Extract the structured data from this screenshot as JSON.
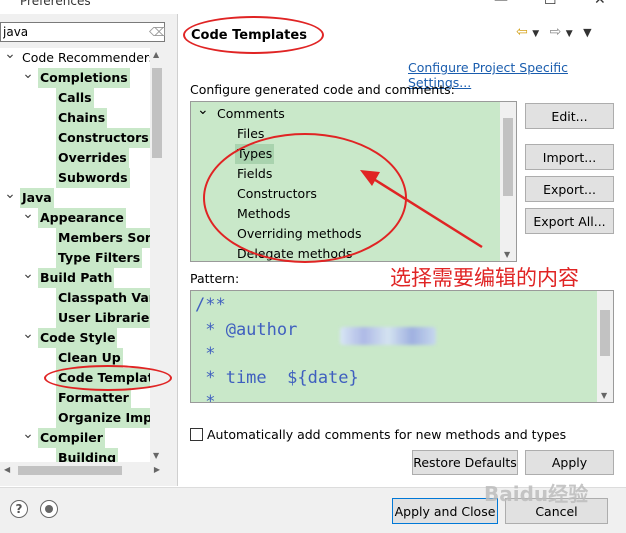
{
  "window": {
    "title": "Preferences",
    "minimize": "—",
    "maximize": "☐",
    "close": "✕"
  },
  "filter": {
    "value": "java",
    "clear_icon": "⌫"
  },
  "tree": [
    {
      "label": "Code Recommenders",
      "level": 0,
      "twisty": "open",
      "highlight": false
    },
    {
      "label": "Completions",
      "level": 1,
      "twisty": "open",
      "highlight": true
    },
    {
      "label": "Calls",
      "level": 2,
      "twisty": "none",
      "highlight": true
    },
    {
      "label": "Chains",
      "level": 2,
      "twisty": "none",
      "highlight": true
    },
    {
      "label": "Constructors",
      "level": 2,
      "twisty": "none",
      "highlight": true
    },
    {
      "label": "Overrides",
      "level": 2,
      "twisty": "none",
      "highlight": true
    },
    {
      "label": "Subwords",
      "level": 2,
      "twisty": "none",
      "highlight": true
    },
    {
      "label": "Java",
      "level": 0,
      "twisty": "open",
      "highlight": true
    },
    {
      "label": "Appearance",
      "level": 1,
      "twisty": "open",
      "highlight": true
    },
    {
      "label": "Members Sort",
      "level": 2,
      "twisty": "none",
      "highlight": true
    },
    {
      "label": "Type Filters",
      "level": 2,
      "twisty": "none",
      "highlight": true
    },
    {
      "label": "Build Path",
      "level": 1,
      "twisty": "open",
      "highlight": true
    },
    {
      "label": "Classpath Vari",
      "level": 2,
      "twisty": "none",
      "highlight": true
    },
    {
      "label": "User Libraries",
      "level": 2,
      "twisty": "none",
      "highlight": true
    },
    {
      "label": "Code Style",
      "level": 1,
      "twisty": "open",
      "highlight": true
    },
    {
      "label": "Clean Up",
      "level": 2,
      "twisty": "none",
      "highlight": true
    },
    {
      "label": "Code Templat",
      "level": 2,
      "twisty": "none",
      "highlight": true
    },
    {
      "label": "Formatter",
      "level": 2,
      "twisty": "none",
      "highlight": true
    },
    {
      "label": "Organize Impo",
      "level": 2,
      "twisty": "none",
      "highlight": true
    },
    {
      "label": "Compiler",
      "level": 1,
      "twisty": "open",
      "highlight": true
    },
    {
      "label": "Building",
      "level": 2,
      "twisty": "none",
      "highlight": true
    }
  ],
  "page": {
    "title": "Code Templates",
    "configure_link": "Configure Project Specific Settings...",
    "configure_label": "Configure generated code and comments:",
    "templates": [
      {
        "label": "Comments",
        "level": 0,
        "twisty": "open",
        "selected": false
      },
      {
        "label": "Files",
        "level": 1,
        "twisty": "none",
        "selected": false
      },
      {
        "label": "Types",
        "level": 1,
        "twisty": "none",
        "selected": true
      },
      {
        "label": "Fields",
        "level": 1,
        "twisty": "none",
        "selected": false
      },
      {
        "label": "Constructors",
        "level": 1,
        "twisty": "none",
        "selected": false
      },
      {
        "label": "Methods",
        "level": 1,
        "twisty": "none",
        "selected": false
      },
      {
        "label": "Overriding methods",
        "level": 1,
        "twisty": "none",
        "selected": false
      },
      {
        "label": "Delegate methods",
        "level": 1,
        "twisty": "none",
        "selected": false
      }
    ],
    "side_buttons": {
      "edit": "Edit...",
      "import": "Import...",
      "export": "Export...",
      "export_all": "Export All..."
    },
    "pattern_label": "Pattern:",
    "pattern_lines": [
      "/**",
      " * @author",
      " *",
      " * time  ${date}",
      " *"
    ],
    "auto_comments_label": "Automatically add comments for new methods and types",
    "restore_defaults": "Restore Defaults",
    "apply": "Apply"
  },
  "bottom": {
    "help_icon": "?",
    "apply_close": "Apply and Close",
    "cancel": "Cancel"
  },
  "annotation": {
    "text": "选择需要编辑的内容",
    "color": "#e02424"
  },
  "watermark": {
    "text": "Baidu经验"
  },
  "colors": {
    "highlight": "#c9e8c9",
    "link": "#1a5dae",
    "pattern_text": "#3f5fbf"
  }
}
